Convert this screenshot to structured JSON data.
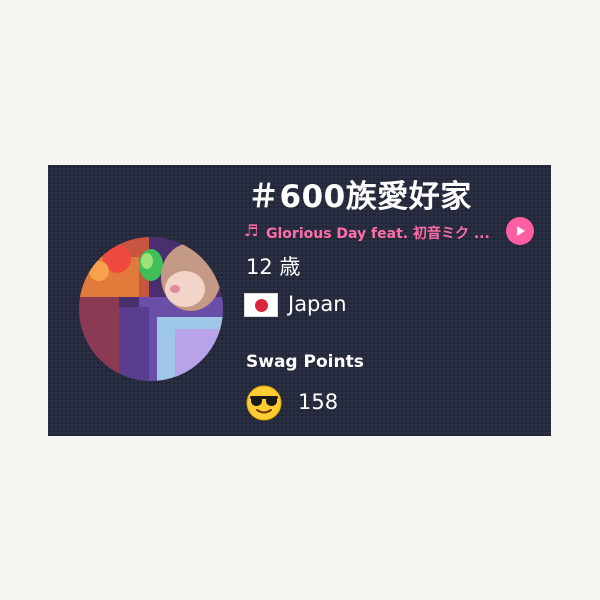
{
  "profile": {
    "title": "＃600族愛好家",
    "music": {
      "icon": "music-note-icon",
      "song": "Glorious Day feat. 初音ミク ..."
    },
    "age": "12 歳",
    "country": {
      "flag_icon": "japan-flag-icon",
      "name": "Japan"
    },
    "swag": {
      "label": "Swag Points",
      "icon": "sunglasses-face-icon",
      "value": "158"
    }
  },
  "colors": {
    "card_background": "#2a2e42",
    "accent_pink": "#ff6ea8",
    "play_button": "#ff5fa2",
    "text": "#ffffff"
  }
}
